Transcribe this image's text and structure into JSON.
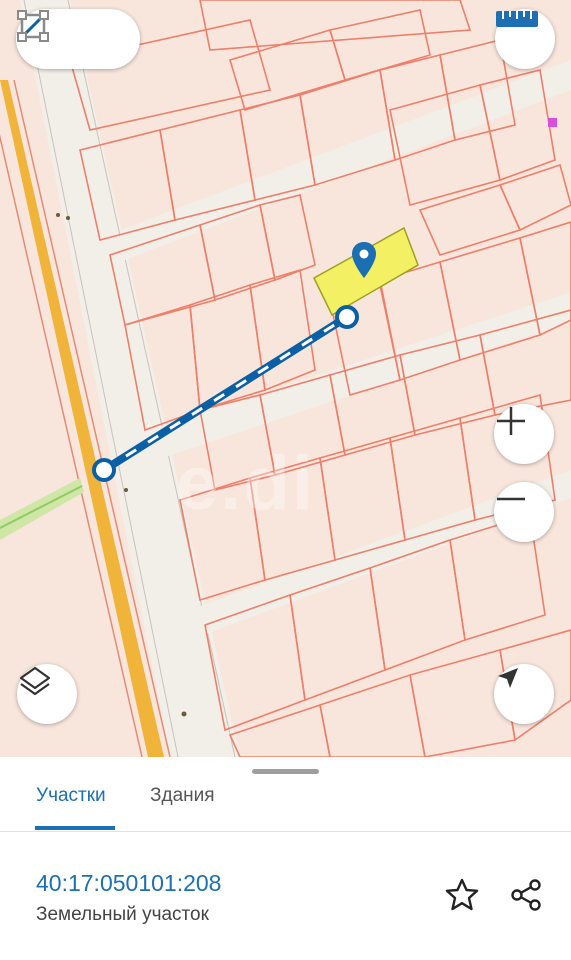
{
  "map": {
    "watermark": "e.di",
    "icons": {
      "measure_line": "ruler-line-icon",
      "measure_area": "area-square-icon",
      "ruler": "ruler-icon",
      "zoom_in": "plus-icon",
      "zoom_out": "minus-icon",
      "layers": "layers-icon",
      "locate": "navigation-arrow-icon",
      "marker": "map-pin-icon"
    },
    "colors": {
      "parcel_border": "#ee7f6a",
      "background": "#f8e6dc",
      "road": "#f0b43a",
      "selected_parcel": "#f4f064",
      "measure_line": "#0b5fa5"
    }
  },
  "sheet": {
    "tabs": [
      {
        "label": "Участки",
        "active": true
      },
      {
        "label": "Здания",
        "active": false
      }
    ],
    "parcel": {
      "cadastral_number": "40:17:050101:208",
      "type": "Земельный участок"
    },
    "icons": {
      "favorite": "star-icon",
      "share": "share-icon"
    }
  }
}
